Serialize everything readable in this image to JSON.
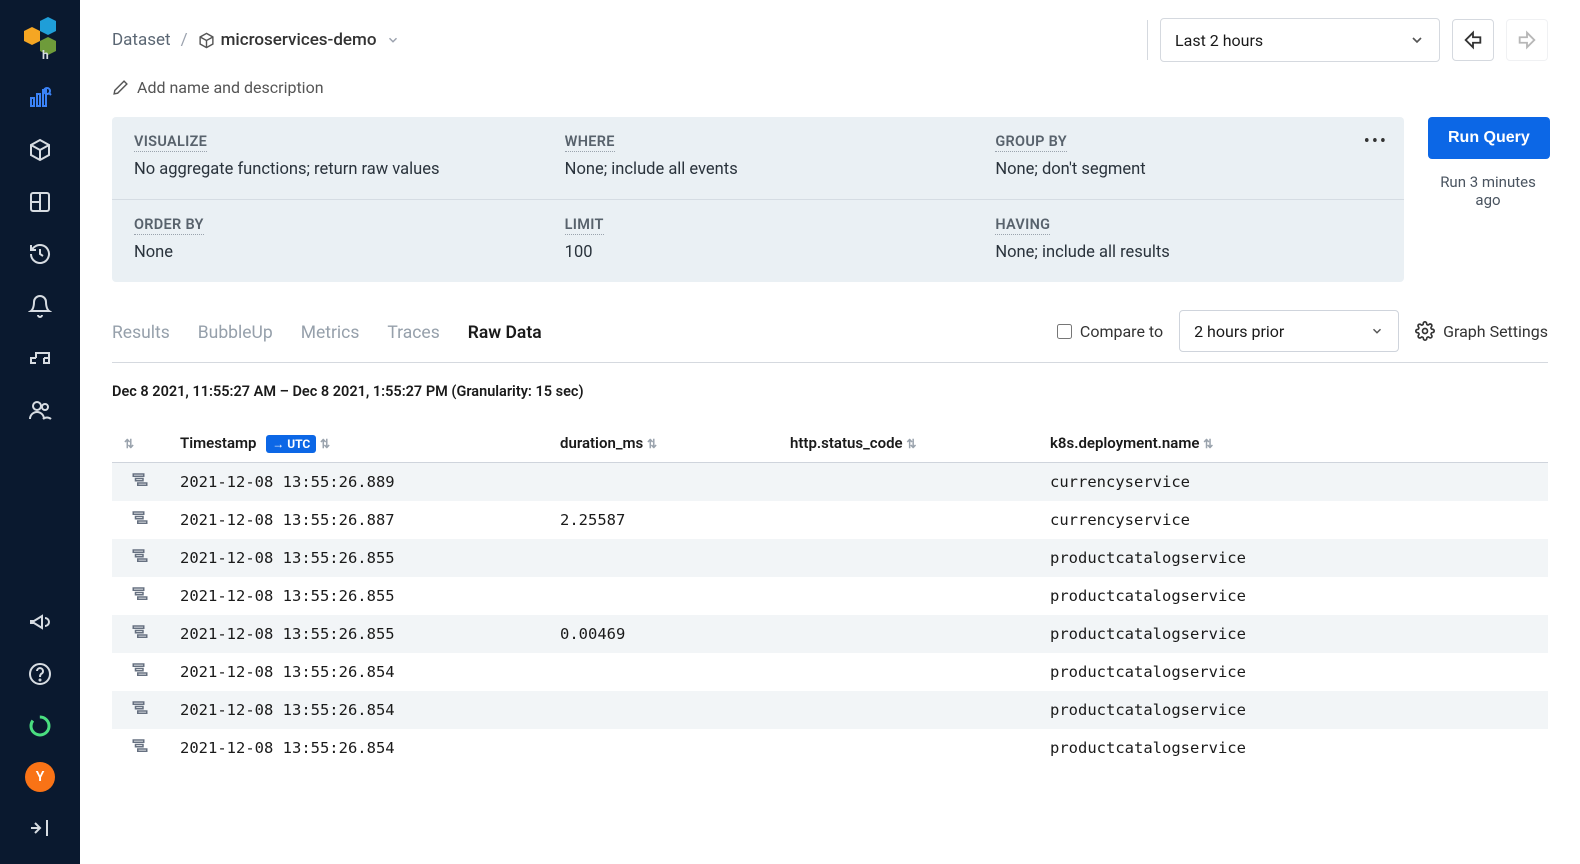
{
  "breadcrumb": {
    "root": "Dataset",
    "sep": "/",
    "item": "microservices-demo"
  },
  "timeRange": "Last 2 hours",
  "addName": "Add name and description",
  "queryBuilder": {
    "visualize": {
      "label": "VISUALIZE",
      "value": "No aggregate functions; return raw values"
    },
    "where": {
      "label": "WHERE",
      "value": "None; include all events"
    },
    "groupby": {
      "label": "GROUP BY",
      "value": "None; don't segment"
    },
    "orderby": {
      "label": "ORDER BY",
      "value": "None"
    },
    "limit": {
      "label": "LIMIT",
      "value": "100"
    },
    "having": {
      "label": "HAVING",
      "value": "None; include all results"
    }
  },
  "runButton": "Run Query",
  "runMeta": "Run 3 minutes ago",
  "tabs": {
    "results": "Results",
    "bubbleup": "BubbleUp",
    "metrics": "Metrics",
    "traces": "Traces",
    "rawdata": "Raw Data"
  },
  "compareLabel": "Compare to",
  "compareValue": "2 hours prior",
  "graphSettings": "Graph Settings",
  "rangeLabel": "Dec 8 2021, 11:55:27 AM – Dec 8 2021, 1:55:27 PM (Granularity: 15 sec)",
  "columns": {
    "timestamp": "Timestamp",
    "utc": "→ UTC",
    "duration": "duration_ms",
    "status": "http.status_code",
    "deployment": "k8s.deployment.name"
  },
  "rows": [
    {
      "ts": "2021-12-08 13:55:26.889",
      "dur": "",
      "status": "",
      "dep": "currencyservice"
    },
    {
      "ts": "2021-12-08 13:55:26.887",
      "dur": "2.25587",
      "status": "",
      "dep": "currencyservice"
    },
    {
      "ts": "2021-12-08 13:55:26.855",
      "dur": "",
      "status": "",
      "dep": "productcatalogservice"
    },
    {
      "ts": "2021-12-08 13:55:26.855",
      "dur": "",
      "status": "",
      "dep": "productcatalogservice"
    },
    {
      "ts": "2021-12-08 13:55:26.855",
      "dur": "0.00469",
      "status": "",
      "dep": "productcatalogservice"
    },
    {
      "ts": "2021-12-08 13:55:26.854",
      "dur": "",
      "status": "",
      "dep": "productcatalogservice"
    },
    {
      "ts": "2021-12-08 13:55:26.854",
      "dur": "",
      "status": "",
      "dep": "productcatalogservice"
    },
    {
      "ts": "2021-12-08 13:55:26.854",
      "dur": "",
      "status": "",
      "dep": "productcatalogservice"
    }
  ],
  "avatar": "Y"
}
